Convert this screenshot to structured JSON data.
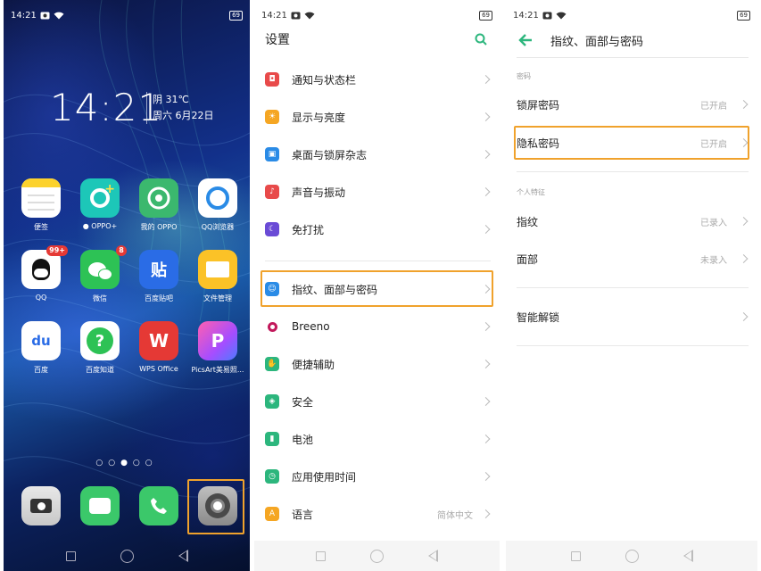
{
  "colors": {
    "accent": "#2cb67d",
    "highlight": "#f0a22c",
    "badge": "#e53935"
  },
  "home": {
    "status_time": "14:21",
    "battery": "69",
    "clock": "14:21",
    "weather": "阴 31℃",
    "date": "周六 6月22日",
    "apps": [
      {
        "label": "便签",
        "icon": "notes-icon"
      },
      {
        "label": "● OPPO+",
        "icon": "oppo-plus-icon"
      },
      {
        "label": "我的 OPPO",
        "icon": "my-oppo-icon"
      },
      {
        "label": "QQ浏览器",
        "icon": "qq-browser-icon"
      },
      {
        "label": "QQ",
        "icon": "qq-icon",
        "badge": "99+"
      },
      {
        "label": "微信",
        "icon": "wechat-icon",
        "badge": "8"
      },
      {
        "label": "百度贴吧",
        "icon": "tieba-icon",
        "glyph": "贴"
      },
      {
        "label": "文件管理",
        "icon": "folder-icon"
      },
      {
        "label": "百度",
        "icon": "baidu-icon",
        "glyph": "du"
      },
      {
        "label": "百度知道",
        "icon": "baidu-zhidao-icon",
        "glyph": "?"
      },
      {
        "label": "WPS Office",
        "icon": "wps-icon",
        "glyph": "W"
      },
      {
        "label": "PicsArt美易照...",
        "icon": "picsart-icon",
        "glyph": "P"
      }
    ],
    "page_dots": "○○●○○",
    "dock": [
      {
        "icon": "camera-icon"
      },
      {
        "icon": "messages-icon"
      },
      {
        "icon": "phone-icon"
      },
      {
        "icon": "settings-gear-icon"
      }
    ]
  },
  "settings": {
    "status_time": "14:21",
    "battery": "69",
    "title": "设置",
    "group1": [
      {
        "label": "通知与状态栏",
        "icon": "notification-icon",
        "color": "#e84a4a"
      },
      {
        "label": "显示与亮度",
        "icon": "brightness-icon",
        "color": "#f5a623"
      },
      {
        "label": "桌面与锁屏杂志",
        "icon": "wallpaper-icon",
        "color": "#2a8be6"
      },
      {
        "label": "声音与振动",
        "icon": "sound-icon",
        "color": "#e84a4a"
      },
      {
        "label": "免打扰",
        "icon": "moon-icon",
        "color": "#6a4bd6"
      }
    ],
    "group2": [
      {
        "label": "指纹、面部与密码",
        "icon": "fingerprint-icon",
        "color": "#2a8be6",
        "value": ""
      },
      {
        "label": "Breeno",
        "icon": "breeno-icon",
        "color": "#c2185b",
        "value": ""
      },
      {
        "label": "便捷辅助",
        "icon": "assist-icon",
        "color": "#2cb67d",
        "value": ""
      },
      {
        "label": "安全",
        "icon": "shield-icon",
        "color": "#2cb67d",
        "value": ""
      },
      {
        "label": "电池",
        "icon": "battery-icon",
        "color": "#2cb67d",
        "value": ""
      },
      {
        "label": "应用使用时间",
        "icon": "app-usage-icon",
        "color": "#2cb67d",
        "value": ""
      },
      {
        "label": "语言",
        "icon": "language-icon",
        "color": "#f5a623",
        "value": "简体中文"
      }
    ]
  },
  "fingerprint": {
    "status_time": "14:21",
    "battery": "69",
    "title": "指纹、面部与密码",
    "section_password": "密码",
    "lock_password": {
      "label": "锁屏密码",
      "value": "已开启"
    },
    "privacy_password": {
      "label": "隐私密码",
      "value": "已开启"
    },
    "section_biometric": "个人特征",
    "fingerprint": {
      "label": "指纹",
      "value": "已录入"
    },
    "face": {
      "label": "面部",
      "value": "未录入"
    },
    "smart_unlock": {
      "label": "智能解锁"
    }
  }
}
